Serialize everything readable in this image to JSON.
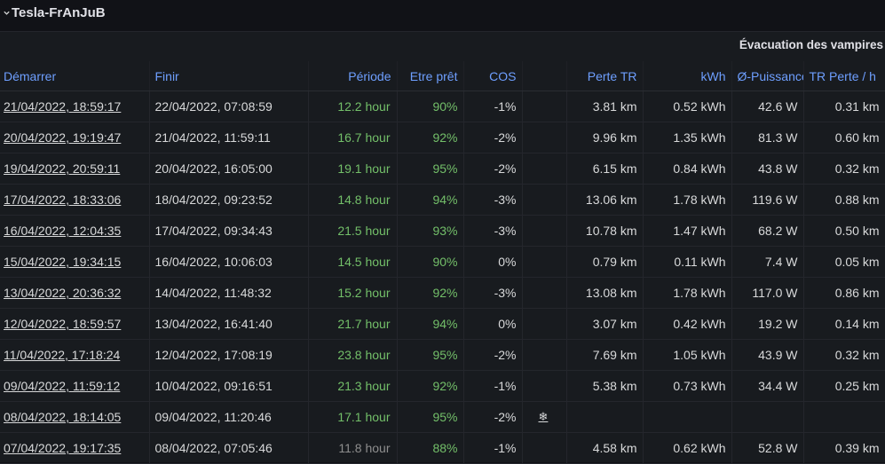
{
  "row": {
    "title": "Tesla-FrAnJuB"
  },
  "panel": {
    "title": "Évacuation des vampires"
  },
  "columns": {
    "start": "Démarrer",
    "end": "Finir",
    "period": "Période",
    "ready": "Etre prêt",
    "cos": "COS",
    "icon": "",
    "loss_tr": "Perte TR",
    "kwh": "kWh",
    "avg_power": "Ø-Puissance",
    "tr_loss_h": "TR Perte / h"
  },
  "rows": [
    {
      "start": "21/04/2022, 18:59:17",
      "end": "22/04/2022, 07:08:59",
      "period": "12.2 hour",
      "ready": "90%",
      "cos": "-1%",
      "icon": "",
      "loss_tr": "3.81 km",
      "kwh": "0.52 kWh",
      "avg_power": "42.6 W",
      "tr_loss_h": "0.31 km",
      "period_color": "#73bf69"
    },
    {
      "start": "20/04/2022, 19:19:47",
      "end": "21/04/2022, 11:59:11",
      "period": "16.7 hour",
      "ready": "92%",
      "cos": "-2%",
      "icon": "",
      "loss_tr": "9.96 km",
      "kwh": "1.35 kWh",
      "avg_power": "81.3 W",
      "tr_loss_h": "0.60 km",
      "period_color": "#73bf69"
    },
    {
      "start": "19/04/2022, 20:59:11",
      "end": "20/04/2022, 16:05:00",
      "period": "19.1 hour",
      "ready": "95%",
      "cos": "-2%",
      "icon": "",
      "loss_tr": "6.15 km",
      "kwh": "0.84 kWh",
      "avg_power": "43.8 W",
      "tr_loss_h": "0.32 km",
      "period_color": "#73bf69"
    },
    {
      "start": "17/04/2022, 18:33:06",
      "end": "18/04/2022, 09:23:52",
      "period": "14.8 hour",
      "ready": "94%",
      "cos": "-3%",
      "icon": "",
      "loss_tr": "13.06 km",
      "kwh": "1.78 kWh",
      "avg_power": "119.6 W",
      "tr_loss_h": "0.88 km",
      "period_color": "#73bf69"
    },
    {
      "start": "16/04/2022, 12:04:35",
      "end": "17/04/2022, 09:34:43",
      "period": "21.5 hour",
      "ready": "93%",
      "cos": "-3%",
      "icon": "",
      "loss_tr": "10.78 km",
      "kwh": "1.47 kWh",
      "avg_power": "68.2 W",
      "tr_loss_h": "0.50 km",
      "period_color": "#73bf69"
    },
    {
      "start": "15/04/2022, 19:34:15",
      "end": "16/04/2022, 10:06:03",
      "period": "14.5 hour",
      "ready": "90%",
      "cos": "0%",
      "icon": "",
      "loss_tr": "0.79 km",
      "kwh": "0.11 kWh",
      "avg_power": "7.4 W",
      "tr_loss_h": "0.05 km",
      "period_color": "#73bf69"
    },
    {
      "start": "13/04/2022, 20:36:32",
      "end": "14/04/2022, 11:48:32",
      "period": "15.2 hour",
      "ready": "92%",
      "cos": "-3%",
      "icon": "",
      "loss_tr": "13.08 km",
      "kwh": "1.78 kWh",
      "avg_power": "117.0 W",
      "tr_loss_h": "0.86 km",
      "period_color": "#73bf69"
    },
    {
      "start": "12/04/2022, 18:59:57",
      "end": "13/04/2022, 16:41:40",
      "period": "21.7 hour",
      "ready": "94%",
      "cos": "0%",
      "icon": "",
      "loss_tr": "3.07 km",
      "kwh": "0.42 kWh",
      "avg_power": "19.2 W",
      "tr_loss_h": "0.14 km",
      "period_color": "#73bf69"
    },
    {
      "start": "11/04/2022, 17:18:24",
      "end": "12/04/2022, 17:08:19",
      "period": "23.8 hour",
      "ready": "95%",
      "cos": "-2%",
      "icon": "",
      "loss_tr": "7.69 km",
      "kwh": "1.05 kWh",
      "avg_power": "43.9 W",
      "tr_loss_h": "0.32 km",
      "period_color": "#73bf69"
    },
    {
      "start": "09/04/2022, 11:59:12",
      "end": "10/04/2022, 09:16:51",
      "period": "21.3 hour",
      "ready": "92%",
      "cos": "-1%",
      "icon": "",
      "loss_tr": "5.38 km",
      "kwh": "0.73 kWh",
      "avg_power": "34.4 W",
      "tr_loss_h": "0.25 km",
      "period_color": "#73bf69"
    },
    {
      "start": "08/04/2022, 18:14:05",
      "end": "09/04/2022, 11:20:46",
      "period": "17.1 hour",
      "ready": "95%",
      "cos": "-2%",
      "icon": "❄",
      "loss_tr": "",
      "kwh": "",
      "avg_power": "",
      "tr_loss_h": "",
      "period_color": "#73bf69"
    },
    {
      "start": "07/04/2022, 19:17:35",
      "end": "08/04/2022, 07:05:46",
      "period": "11.8 hour",
      "ready": "88%",
      "cos": "-1%",
      "icon": "",
      "loss_tr": "4.58 km",
      "kwh": "0.62 kWh",
      "avg_power": "52.8 W",
      "tr_loss_h": "0.39 km",
      "period_color": "#8e8e8e"
    }
  ]
}
